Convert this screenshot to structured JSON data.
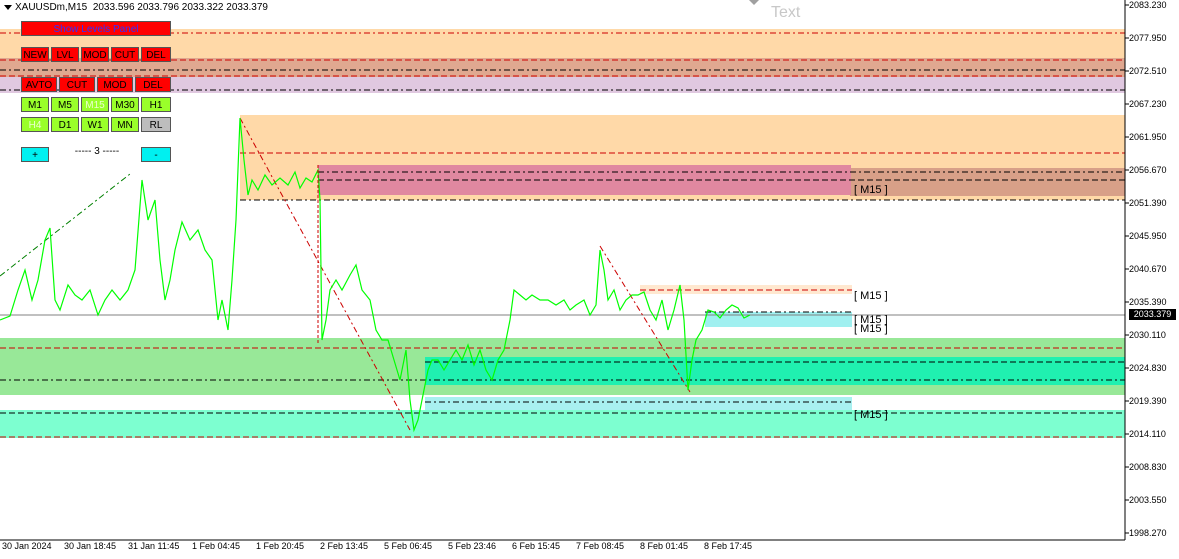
{
  "header": {
    "symbol": "XAUUSDm,M15",
    "ohlc": "2033.596 2033.796 2033.322 2033.379"
  },
  "watermark": "Text",
  "panel": {
    "show_levels": "Show Levels Panel",
    "row1": [
      "NEW",
      "LVL",
      "MOD",
      "CUT",
      "DEL"
    ],
    "row2": [
      "AVTO",
      "CUT",
      "MOD",
      "DEL"
    ],
    "timeframes_row1": [
      "M1",
      "M5",
      "M15",
      "M30",
      "H1"
    ],
    "timeframes_row2": [
      "H4",
      "D1",
      "W1",
      "MN",
      "RL"
    ],
    "plus": "+",
    "minus": "-",
    "counter": "----- 3 -----"
  },
  "price_axis": [
    "2083.230",
    "2077.950",
    "2072.510",
    "2067.230",
    "2061.950",
    "2056.670",
    "2051.390",
    "2045.950",
    "2040.670",
    "2035.390",
    "2030.110",
    "2024.830",
    "2019.390",
    "2014.110",
    "2008.830",
    "2003.550",
    "1998.270"
  ],
  "current_price": "2033.379",
  "time_axis": [
    "30 Jan 2024",
    "30 Jan 18:45",
    "31 Jan 11:45",
    "1 Feb 04:45",
    "1 Feb 20:45",
    "2 Feb 13:45",
    "5 Feb 06:45",
    "5 Feb 23:46",
    "6 Feb 15:45",
    "7 Feb 08:45",
    "8 Feb 01:45",
    "8 Feb 17:45"
  ],
  "zone_labels": [
    "[ M15 ]",
    "[ M15 ]",
    "[ M15 ]",
    "[ M15 ]",
    "[ M15 ]"
  ],
  "colors": {
    "price_line": "#00ff00",
    "supply_zone": "#ffd9a8",
    "demand_zone": "#7dffd0",
    "dashed_red": "#cc0000"
  }
}
